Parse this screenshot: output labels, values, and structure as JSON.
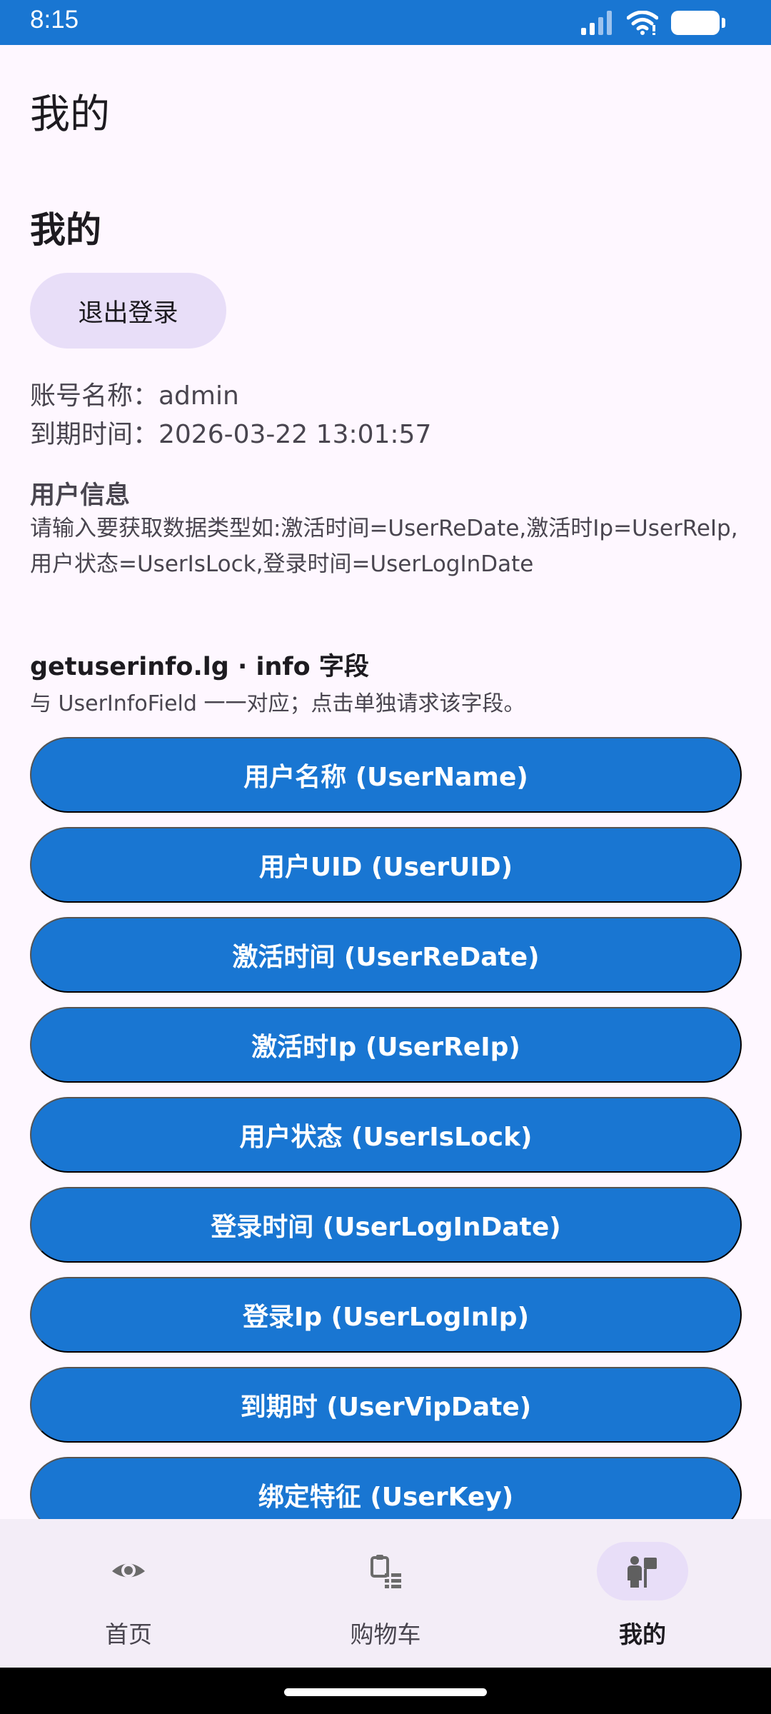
{
  "status": {
    "time": "8:15"
  },
  "page_title": "我的",
  "section_title": "我的",
  "logout_label": "退出登录",
  "account": {
    "name_line": "账号名称：admin",
    "expiry_line": "到期时间：2026-03-22 13:01:57"
  },
  "user_info": {
    "title": "用户信息",
    "description": "请输入要获取数据类型如:激活时间=UserReDate,激活时Ip=UserReIp,用户状态=UserIsLock,登录时间=UserLogInDate"
  },
  "fields": {
    "title": "getuserinfo.lg · info 字段",
    "description": "与 UserInfoField 一一对应；点击单独请求该字段。",
    "buttons": [
      "用户名称 (UserName)",
      "用户UID (UserUID)",
      "激活时间 (UserReDate)",
      "激活时Ip (UserReIp)",
      "用户状态 (UserIsLock)",
      "登录时间 (UserLogInDate)",
      "登录Ip (UserLogInIp)",
      "到期时 (UserVipDate)",
      "绑定特征 (UserKey)"
    ]
  },
  "nav": {
    "items": [
      {
        "label": "首页",
        "icon": "eye-icon"
      },
      {
        "label": "购物车",
        "icon": "cart-list-icon"
      },
      {
        "label": "我的",
        "icon": "profile-icon",
        "active": true
      }
    ]
  },
  "colors": {
    "primary": "#1976D2",
    "background": "#FEF7FF",
    "secondary_container": "#E8DEF8",
    "nav_background": "#F3EDF7"
  }
}
